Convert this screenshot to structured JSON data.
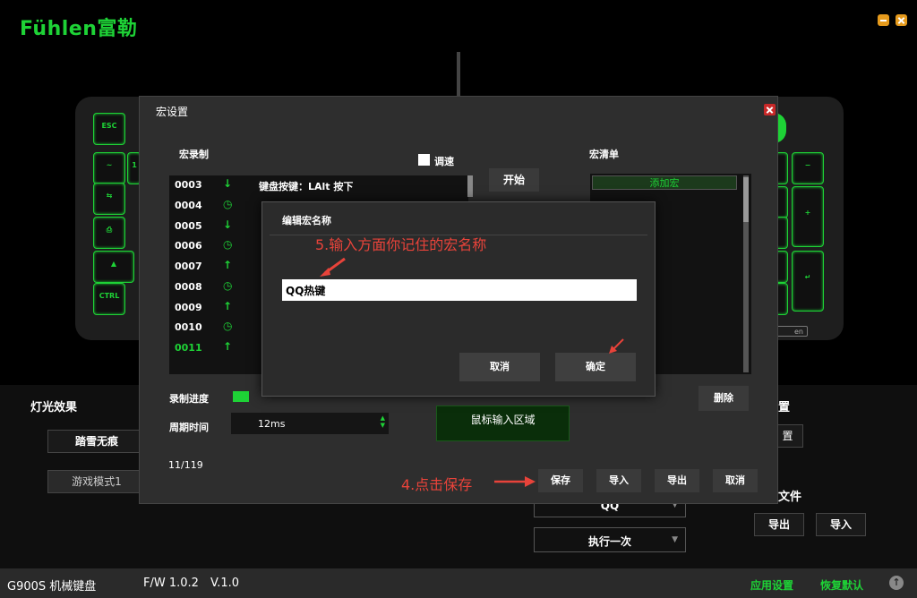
{
  "brand": {
    "name": "Fühlen富勒"
  },
  "window_controls": {
    "minimize_icon": "minimize-icon",
    "close_icon": "close-icon"
  },
  "keyboard": {
    "keys": [
      "ESC",
      "~",
      "1",
      "⇆",
      "⎙",
      "▲",
      "CTRL",
      "−",
      "+",
      "↵"
    ],
    "brand_plate": "en"
  },
  "lower_panel": {
    "lighting_title": "灯光效果",
    "lighting_select": "踏雪无痕",
    "game_mode_button": "游戏模式1",
    "settings_title_fragment": "置",
    "settings_button_fragment": "置",
    "file_title_fragment": "文件",
    "export_button": "导出",
    "import_button": "导入",
    "macro_select": "QQ",
    "run_select": "执行一次"
  },
  "status_bar": {
    "device": "G900S 机械键盘",
    "firmware": "F/W 1.0.2",
    "version": "V.1.0",
    "app_settings": "应用设置",
    "restore_default": "恢复默认"
  },
  "macro_dialog": {
    "title": "宏设置",
    "record_label": "宏录制",
    "speed_label": "调速",
    "start_button": "开始",
    "list_label": "宏清单",
    "add_macro": "添加宏",
    "rows": [
      {
        "num": "0003",
        "icon": "↓",
        "text": "键盘按键：LAlt 按下",
        "active": false
      },
      {
        "num": "0004",
        "icon": "◷",
        "text": "",
        "active": false
      },
      {
        "num": "0005",
        "icon": "↓",
        "text": "",
        "active": false
      },
      {
        "num": "0006",
        "icon": "◷",
        "text": "",
        "active": false
      },
      {
        "num": "0007",
        "icon": "↑",
        "text": "",
        "active": false
      },
      {
        "num": "0008",
        "icon": "◷",
        "text": "",
        "active": false
      },
      {
        "num": "0009",
        "icon": "↑",
        "text": "",
        "active": false
      },
      {
        "num": "0010",
        "icon": "◷",
        "text": "",
        "active": false
      },
      {
        "num": "0011",
        "icon": "↑",
        "text": "",
        "active": true
      }
    ],
    "progress_label": "录制进度",
    "period_label": "周期时间",
    "period_value": "12ms",
    "mouse_area": "鼠标输入区域",
    "delete_button": "删除",
    "counter": "11/119",
    "save_button": "保存",
    "import_button": "导入",
    "export_button": "导出",
    "cancel_button": "取消"
  },
  "edit_modal": {
    "title": "编辑宏名称",
    "input_value": "QQ热键",
    "cancel_button": "取消",
    "ok_button": "确定"
  },
  "annotations": {
    "step5": "5.输入方面你记住的宏名称",
    "step4": "4.点击保存"
  },
  "colors": {
    "accent": "#1ed236",
    "annotation": "#e8433a",
    "window_button": "#e59a1c",
    "dialog_close": "#c82828"
  }
}
